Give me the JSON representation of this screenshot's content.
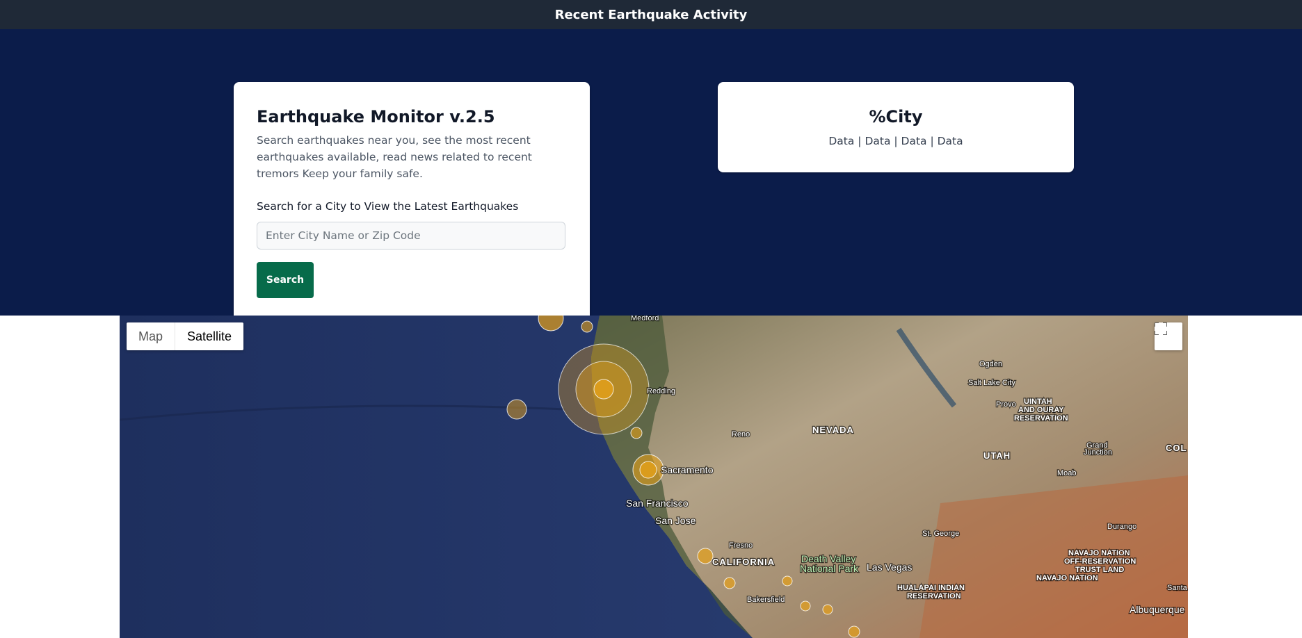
{
  "header": {
    "title": "Recent Earthquake Activity"
  },
  "monitor": {
    "title": "Earthquake Monitor v.2.5",
    "description": "Search earthquakes near you, see the most recent earthquakes available, read news related to recent tremors Keep your family safe.",
    "search_label": "Search for a City to View the Latest Earthquakes",
    "search_placeholder": "Enter City Name or Zip Code",
    "search_value": "",
    "search_button": "Search"
  },
  "city_card": {
    "title": "%City",
    "data_line": "Data | Data | Data | Data"
  },
  "map": {
    "type_buttons": {
      "map": "Map",
      "satellite": "Satellite"
    },
    "active_type": "Satellite",
    "labels": {
      "medford": "Medford",
      "redding": "Redding",
      "reno": "Reno",
      "nevada": "NEVADA",
      "ogden": "Ogden",
      "salt_lake_city": "Salt Lake City",
      "provo": "Provo",
      "uintah_1": "UINTAH",
      "uintah_2": "AND OURAY",
      "uintah_3": "RESERVATION",
      "utah": "UTAH",
      "grand_junction_1": "Grand",
      "grand_junction_2": "Junction",
      "colorado": "COL",
      "moab": "Moab",
      "sacramento": "Sacramento",
      "san_francisco": "San Francisco",
      "san_jose": "San Jose",
      "fresno": "Fresno",
      "california": "CALIFORNIA",
      "death_valley_1": "Death Valley",
      "death_valley_2": "National Park",
      "las_vegas": "Las Vegas",
      "st_george": "St. George",
      "durango": "Durango",
      "navajo_1": "NAVAJO NATION",
      "navajo_2": "OFF-RESERVATION",
      "navajo_3": "TRUST LAND",
      "navajo_4": "NAVAJO NATION",
      "hualapai_1": "HUALAPAI INDIAN",
      "hualapai_2": "RESERVATION",
      "bakersfield": "Bakersfield",
      "santa_fe": "Santa",
      "albuquerque": "Albuquerque"
    },
    "icons": {
      "fullscreen": "fullscreen-icon",
      "earthquake_marker": "earthquake-circle-marker"
    }
  }
}
